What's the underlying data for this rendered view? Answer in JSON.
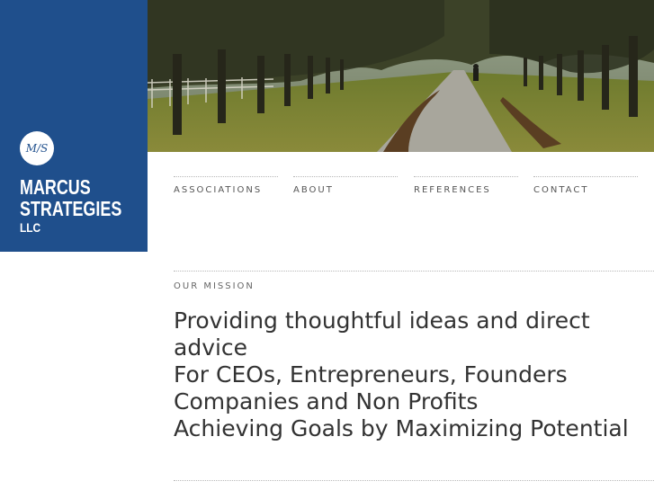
{
  "brand": {
    "monogram": "M/S",
    "line1": "MARCUS",
    "line2": "STRATEGIES",
    "line3": "LLC",
    "color": "#1f4f8c"
  },
  "nav": {
    "items": [
      {
        "label": "ASSOCIATIONS"
      },
      {
        "label": "ABOUT"
      },
      {
        "label": "REFERENCES"
      },
      {
        "label": "CONTACT"
      }
    ]
  },
  "mission": {
    "label": "OUR MISSION",
    "lines": [
      "Providing thoughtful ideas and direct advice",
      "For CEOs, Entrepreneurs, Founders",
      "Companies and Non Profits",
      "Achieving Goals by Maximizing Potential"
    ]
  }
}
